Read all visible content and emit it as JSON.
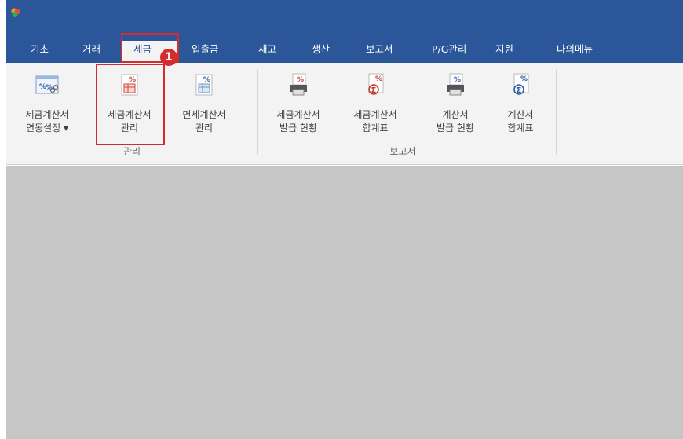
{
  "tabs": [
    {
      "label": "기초"
    },
    {
      "label": "거래"
    },
    {
      "label": "세금"
    },
    {
      "label": "입출금"
    },
    {
      "label": "재고"
    },
    {
      "label": "생산"
    },
    {
      "label": "보고서"
    },
    {
      "label": "P/G관리"
    },
    {
      "label": "지원"
    },
    {
      "label": "나의메뉴"
    }
  ],
  "active_tab": "세금",
  "ribbon": {
    "buttons": [
      {
        "line1": "세금계산서",
        "line2": "연동설정 ▾",
        "icon": "tax-invoice-link-settings-icon"
      },
      {
        "line1": "세금계산서",
        "line2": "관리",
        "icon": "tax-invoice-table-icon"
      },
      {
        "line1": "면세계산서",
        "line2": "관리",
        "icon": "tax-free-invoice-table-icon"
      },
      {
        "line1": "세금계산서",
        "line2": "발급 현황",
        "icon": "printer-percent-icon"
      },
      {
        "line1": "세금계산서",
        "line2": "합계표",
        "icon": "sum-percent-icon"
      },
      {
        "line1": "계산서",
        "line2": "발급 현황",
        "icon": "printer-percent-icon"
      },
      {
        "line1": "계산서",
        "line2": "합계표",
        "icon": "sum-percent-icon"
      }
    ],
    "groups": {
      "manage": "관리",
      "report": "보고서"
    }
  },
  "annotation": {
    "step": "1"
  },
  "colors": {
    "titlebar": "#2b579a",
    "ribbon": "#f3f3f3",
    "workspace": "#c6c6c6",
    "highlight": "#d52b2b"
  }
}
